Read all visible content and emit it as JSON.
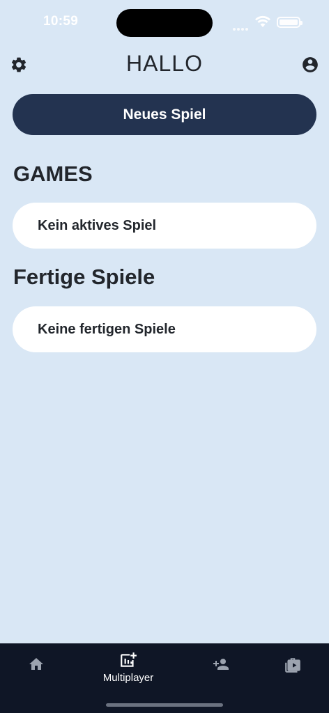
{
  "status_bar": {
    "time": "10:59"
  },
  "header": {
    "title": "HALLO"
  },
  "actions": {
    "new_game_label": "Neues Spiel"
  },
  "sections": {
    "games_title": "GAMES",
    "games_empty": "Kein aktives Spiel",
    "finished_title": "Fertige Spiele",
    "finished_empty": "Keine fertigen Spiele"
  },
  "tabbar": {
    "items": [
      {
        "icon": "home-icon",
        "label": ""
      },
      {
        "icon": "multiplayer-icon",
        "label": "Multiplayer"
      },
      {
        "icon": "add-person-icon",
        "label": ""
      },
      {
        "icon": "video-library-icon",
        "label": ""
      }
    ],
    "active_index": 1
  },
  "colors": {
    "background": "#d9e7f5",
    "primary_button": "#233350",
    "tabbar": "#0f1626",
    "text": "#22262c"
  }
}
